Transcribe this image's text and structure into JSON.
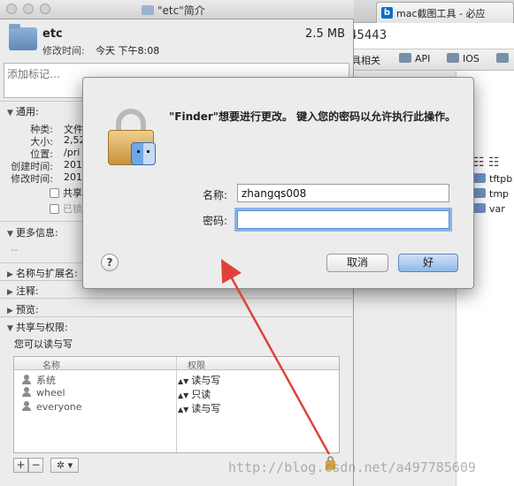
{
  "browser": {
    "tab_title": "mac截图工具 - 必应",
    "tab_icon": "b",
    "url_fragment": "45443",
    "bookmarks": [
      {
        "label": "具相关",
        "icon": "none"
      },
      {
        "label": "API",
        "icon": "folder-icon"
      },
      {
        "label": "IOS",
        "icon": "folder-icon"
      }
    ],
    "toolbar_icons": "☷ ☷",
    "files": [
      "tftpb",
      "tmp",
      "var"
    ]
  },
  "info": {
    "window_title": "\"etc\"简介",
    "name": "etc",
    "size": "2.5 MB",
    "modified_label": "修改时间:",
    "modified_value": "今天 下午8:08",
    "tags_placeholder": "添加标记…",
    "general": {
      "header": "通用:",
      "rows": [
        {
          "label": "种类:",
          "value": "文件"
        },
        {
          "label": "大小:",
          "value": "2,52"
        },
        {
          "label": "位置:",
          "value": "/pri"
        },
        {
          "label": "创建时间:",
          "value": "201"
        },
        {
          "label": "修改时间:",
          "value": "201"
        }
      ],
      "shared_label": "共享",
      "locked_label": "已锁"
    },
    "more_info": {
      "header": "更多信息:",
      "value": "--"
    },
    "name_ext_header": "名称与扩展名:",
    "comments_header": "注释:",
    "preview_header": "预览:",
    "sharing": {
      "header": "共享与权限:",
      "caption": "您可以读与写",
      "col_name": "名称",
      "col_priv": "权限",
      "rows": [
        {
          "user": "系统",
          "priv": "读与写"
        },
        {
          "user": "wheel",
          "priv": "只读"
        },
        {
          "user": "everyone",
          "priv": "读与写"
        }
      ]
    },
    "bottom": {
      "add": "+",
      "remove": "−",
      "gear": "✲ ▾"
    }
  },
  "auth": {
    "message": "\"Finder\"想要进行更改。 键入您的密码以允许执行此操作。",
    "name_label": "名称:",
    "name_value": "zhangqs008",
    "password_label": "密码:",
    "password_value": "",
    "help": "?",
    "cancel": "取消",
    "ok": "好"
  },
  "watermark": "http://blog.csdn.net/a497785609",
  "colors": {
    "arrow": "#e0423a",
    "default_button": "#8fb9ea",
    "focus_ring": "#8bb3e8"
  }
}
